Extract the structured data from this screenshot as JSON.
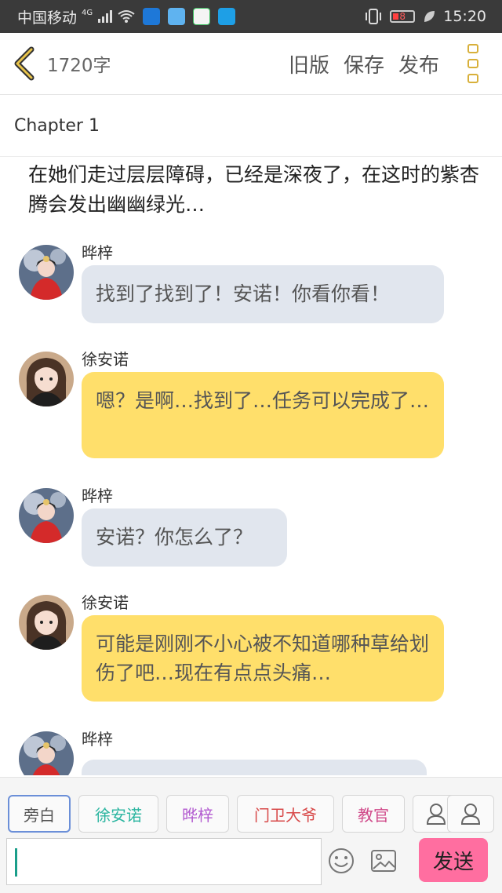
{
  "status": {
    "carrier": "中国移动",
    "network": "4G",
    "battery": "8",
    "time": "15:20"
  },
  "header": {
    "word_count": "1720字",
    "actions": [
      "旧版",
      "保存",
      "发布"
    ]
  },
  "chapter": {
    "title": "Chapter 1"
  },
  "narration": "在她们走过层层障碍，已经是深夜了，在这时的紫杏腾会发出幽幽绿光…",
  "messages": [
    {
      "speaker": "晔梓",
      "text": "找到了找到了！安诺！你看你看！"
    },
    {
      "speaker": "徐安诺",
      "text": "嗯？是啊…找到了…任务可以完成了…"
    },
    {
      "speaker": "晔梓",
      "text": "安诺？你怎么了？"
    },
    {
      "speaker": "徐安诺",
      "text": "可能是刚刚不小心被不知道哪种草给划伤了吧…现在有点点头痛…"
    },
    {
      "speaker": "晔梓",
      "text": ""
    }
  ],
  "characters": [
    {
      "name": "旁白",
      "color": "#555555"
    },
    {
      "name": "徐安诺",
      "color": "#2bb5a0"
    },
    {
      "name": "晔梓",
      "color": "#b25ad0"
    },
    {
      "name": "门卫大爷",
      "color": "#d84a4a"
    },
    {
      "name": "教官",
      "color": "#d04a8a"
    }
  ],
  "composer": {
    "input_value": "",
    "send_label": "发送"
  }
}
